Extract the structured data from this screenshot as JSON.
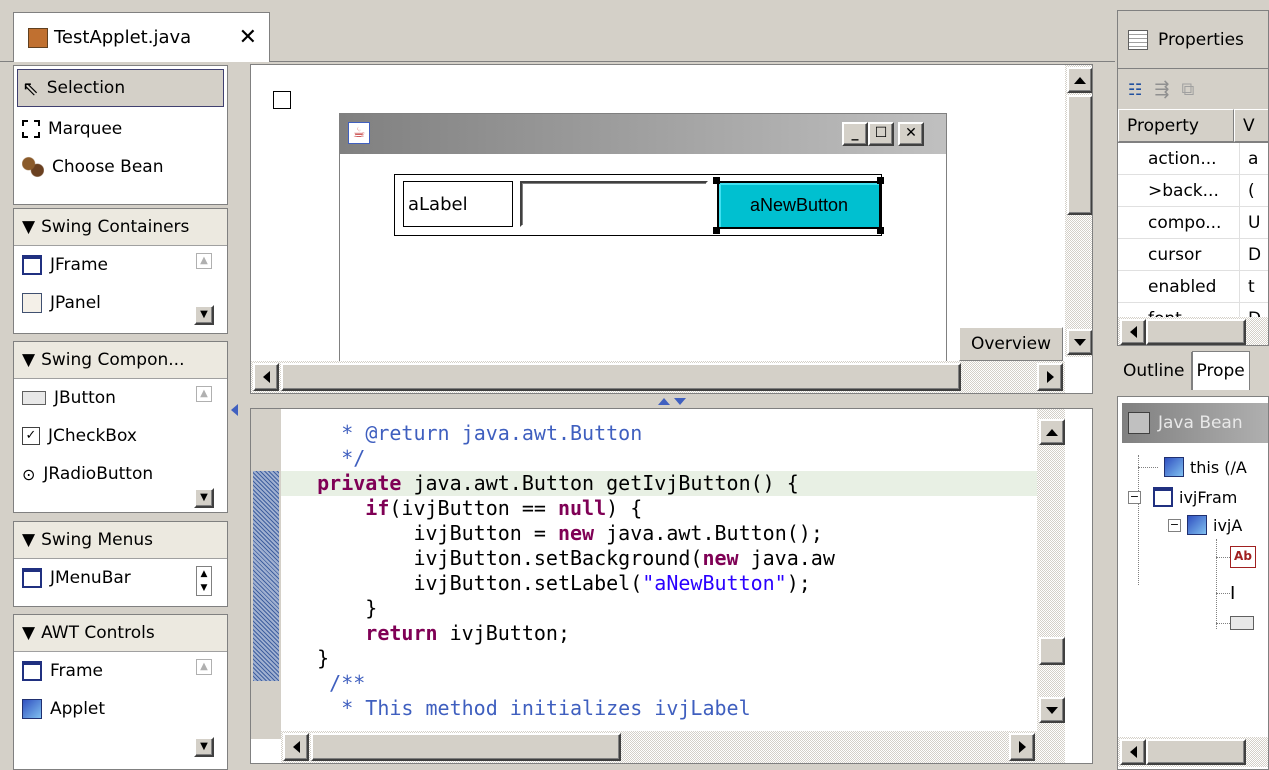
{
  "editor_tab": {
    "title": "TestApplet.java",
    "close": "✕"
  },
  "palette": {
    "tools": [
      {
        "label": "Selection",
        "icon": "arrow-cursor-icon"
      },
      {
        "label": "Marquee",
        "icon": "marquee-icon"
      },
      {
        "label": "Choose Bean",
        "icon": "beans-icon"
      }
    ],
    "groups": [
      {
        "title": "Swing Containers",
        "items": [
          "JFrame",
          "JPanel"
        ]
      },
      {
        "title": "Swing Compon...",
        "items": [
          "JButton",
          "JCheckBox",
          "JRadioButton"
        ]
      },
      {
        "title": "Swing Menus",
        "items": [
          "JMenuBar"
        ]
      },
      {
        "title": "AWT Controls",
        "items": [
          "Frame",
          "Applet"
        ]
      }
    ]
  },
  "canvas": {
    "label_text": "aLabel",
    "textfield_value": "",
    "button_text": "aNewButton",
    "overview_label": "Overview",
    "button_color": "#00c0d0"
  },
  "code_lines": [
    {
      "indent": "     ",
      "parts": [
        {
          "t": "* ",
          "c": "cm"
        },
        {
          "t": "@return",
          "c": "cm"
        },
        {
          "t": " java.awt.Button",
          "c": "cm"
        }
      ]
    },
    {
      "indent": "     ",
      "parts": [
        {
          "t": "*/",
          "c": "cm"
        }
      ]
    },
    {
      "indent": "   ",
      "parts": [
        {
          "t": "private",
          "c": "kw"
        },
        {
          "t": " java.awt.Button getIvjButton() {",
          "c": ""
        }
      ]
    },
    {
      "indent": "       ",
      "parts": [
        {
          "t": "if",
          "c": "kw"
        },
        {
          "t": "(ivjButton == ",
          "c": ""
        },
        {
          "t": "null",
          "c": "kw"
        },
        {
          "t": ") {",
          "c": ""
        }
      ]
    },
    {
      "indent": "           ",
      "parts": [
        {
          "t": "ivjButton = ",
          "c": ""
        },
        {
          "t": "new",
          "c": "kw"
        },
        {
          "t": " java.awt.Button();",
          "c": ""
        }
      ]
    },
    {
      "indent": "           ",
      "parts": [
        {
          "t": "ivjButton.setBackground(",
          "c": ""
        },
        {
          "t": "new",
          "c": "kw"
        },
        {
          "t": " java.aw",
          "c": ""
        }
      ]
    },
    {
      "indent": "           ",
      "parts": [
        {
          "t": "ivjButton.setLabel(",
          "c": ""
        },
        {
          "t": "\"aNewButton\"",
          "c": "str"
        },
        {
          "t": ");",
          "c": ""
        }
      ]
    },
    {
      "indent": "       ",
      "parts": [
        {
          "t": "}",
          "c": ""
        }
      ]
    },
    {
      "indent": "       ",
      "parts": [
        {
          "t": "return",
          "c": "kw"
        },
        {
          "t": " ivjButton;",
          "c": ""
        }
      ]
    },
    {
      "indent": "   ",
      "parts": [
        {
          "t": "}",
          "c": ""
        }
      ]
    },
    {
      "indent": "    ",
      "parts": [
        {
          "t": "/**",
          "c": "cm"
        }
      ]
    },
    {
      "indent": "     ",
      "parts": [
        {
          "t": "* This method initializes ivjLabel",
          "c": "cm"
        }
      ]
    }
  ],
  "properties": {
    "tab_title": "Properties",
    "columns": [
      "Property",
      "V"
    ],
    "rows": [
      {
        "name": "action...",
        "value": "a"
      },
      {
        "name": ">back...",
        "value": "("
      },
      {
        "name": "compo...",
        "value": "U"
      },
      {
        "name": "cursor",
        "value": "D"
      },
      {
        "name": "enabled",
        "value": "t"
      },
      {
        "name": "font",
        "value": "D"
      }
    ]
  },
  "bottom_tabs": [
    "Outline",
    "Prope"
  ],
  "java_beans": {
    "title": "Java Bean",
    "nodes": [
      {
        "label": "this (/A",
        "level": 0
      },
      {
        "label": "ivjFram",
        "level": 0
      },
      {
        "label": "ivjA",
        "level": 1
      }
    ]
  }
}
